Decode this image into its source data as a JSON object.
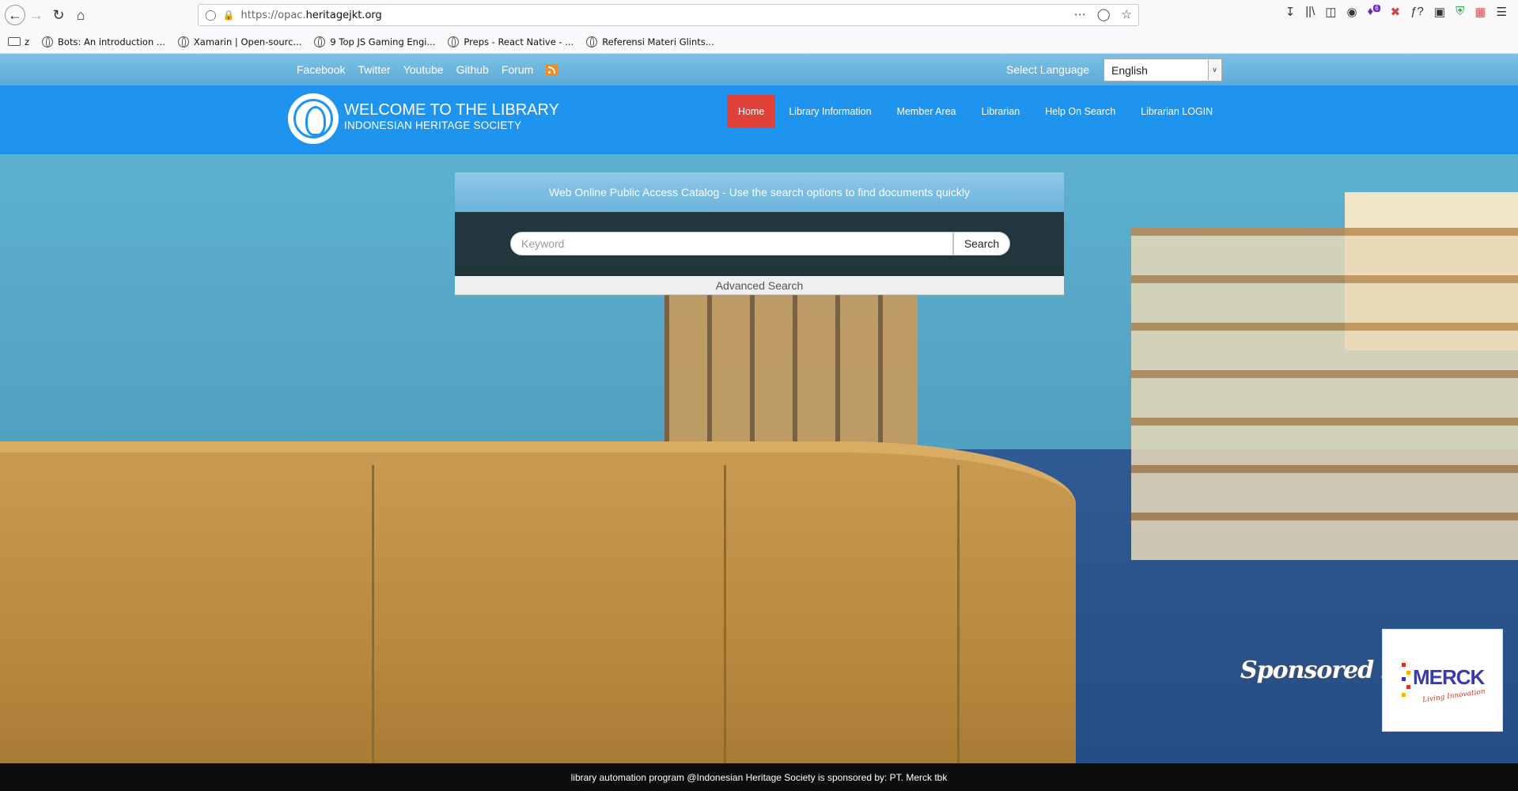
{
  "browser": {
    "url_prefix": "https://opac.",
    "url_domain": "heritagejkt.org",
    "bookmarks": [
      {
        "label": "z",
        "icon": "folder-icon"
      },
      {
        "label": "Bots: An introduction ...",
        "icon": "globe-icon"
      },
      {
        "label": "Xamarin | Open-sourc...",
        "icon": "globe-icon"
      },
      {
        "label": "9 Top JS Gaming Engi...",
        "icon": "globe-icon"
      },
      {
        "label": "Preps - React Native - ...",
        "icon": "globe-icon"
      },
      {
        "label": "Referensi Materi Glints...",
        "icon": "globe-icon"
      }
    ],
    "extension_badge": "6"
  },
  "topbar": {
    "social": [
      "Facebook",
      "Twitter",
      "Youtube",
      "Github",
      "Forum"
    ],
    "language_label": "Select Language",
    "language_value": "English"
  },
  "header": {
    "title": "WELCOME TO THE LIBRARY",
    "subtitle": "INDONESIAN HERITAGE SOCIETY",
    "menu": [
      "Home",
      "Library Information",
      "Member Area",
      "Librarian",
      "Help On Search",
      "Librarian LOGIN"
    ],
    "active_color": "#e0423a",
    "header_color": "#1e94ee"
  },
  "catalog": {
    "heading": "Web Online Public Access Catalog - Use the search options to find documents quickly",
    "placeholder": "Keyword",
    "search_label": "Search",
    "advanced_label": "Advanced Search"
  },
  "sponsor": {
    "label": "Sponsored by :",
    "brand": "MERCK",
    "tagline": "Living Innovation"
  },
  "footer": {
    "text": "library automation program @Indonesian Heritage Society is sponsored by: PT. Merck tbk"
  }
}
